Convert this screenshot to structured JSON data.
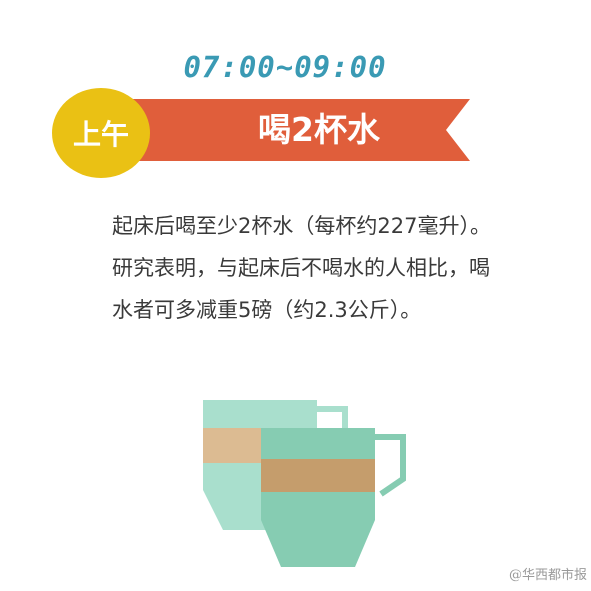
{
  "header": {
    "time_range": "07:00~09:00",
    "period_badge": "上午",
    "title": "喝2杯水"
  },
  "content": {
    "description": "起床后喝至少2杯水（每杯约227毫升）。研究表明，与起床后不喝水的人相比，喝水者可多减重5磅（约2.3公斤）。"
  },
  "footer": {
    "watermark": "@华西都市报"
  },
  "colors": {
    "time_text": "#3a9ab4",
    "ribbon": "#e05e3b",
    "badge": "#eac114",
    "cup_back": "#a9dfcd",
    "cup_front": "#86ccb2",
    "band_back": "#dcbb92",
    "band_front": "#c59d6c"
  },
  "icons": [
    "two-cups-illustration"
  ]
}
